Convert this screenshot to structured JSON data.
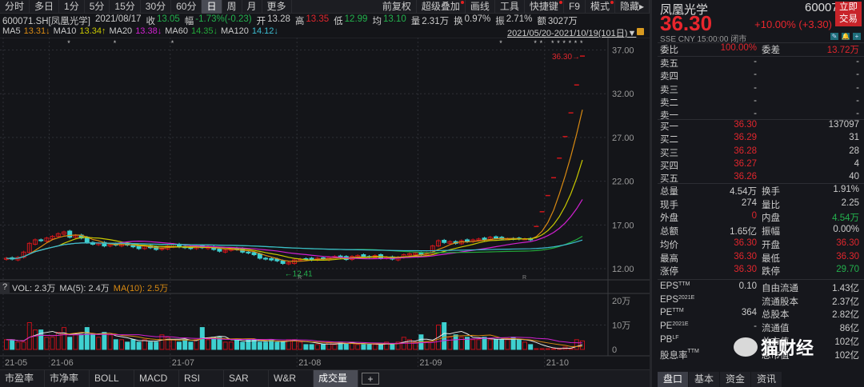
{
  "toolbar": {
    "left": [
      "分时",
      "多日",
      "1分",
      "5分",
      "15分",
      "30分",
      "60分",
      "日",
      "周",
      "月",
      "更多"
    ],
    "active": "日",
    "right": [
      {
        "label": "前复权",
        "dot": false
      },
      {
        "label": "超级叠加",
        "dot": true
      },
      {
        "label": "画线",
        "dot": false
      },
      {
        "label": "工具",
        "dot": false
      },
      {
        "label": "快捷键",
        "dot": true
      },
      {
        "label": "F9",
        "dot": false
      },
      {
        "label": "模式",
        "dot": true
      },
      {
        "label": "隐藏▸",
        "dot": false
      }
    ]
  },
  "info": {
    "symbol": "600071.SH[凤凰光学]",
    "date": "2021/08/17",
    "close_label": "收",
    "close": "13.05",
    "amp_label": "幅",
    "change": "-1.73%(-0.23)",
    "open_label": "开",
    "open": "13.28",
    "high_label": "高",
    "high": "13.35",
    "low_label": "低",
    "low": "12.99",
    "avg_label": "均",
    "avg": "13.10",
    "vol_label": "量",
    "vol": "2.31万",
    "turnover_label": "换",
    "turnover": "0.97%",
    "swing_label": "振",
    "swing": "2.71%",
    "amount_label": "额",
    "amount": "3027万"
  },
  "ma": [
    {
      "label": "MA5",
      "value": "13.31↓",
      "color": "#d98a12"
    },
    {
      "label": "MA10",
      "value": "13.34↑",
      "color": "#c8c800"
    },
    {
      "label": "MA20",
      "value": "13.38↓",
      "color": "#d020d0"
    },
    {
      "label": "MA60",
      "value": "14.35↓",
      "color": "#22a83a"
    },
    {
      "label": "MA120",
      "value": "14.12↓",
      "color": "#3cbcd0"
    }
  ],
  "range": "2021/05/20-2021/10/19(101日)▼",
  "chart_data": {
    "type": "candlestick",
    "ylim": [
      11,
      37.5
    ],
    "yticks": [
      "37.00",
      "32.00",
      "27.00",
      "22.00",
      "17.00",
      "12.00"
    ],
    "ytick_values": [
      37,
      32,
      27,
      22,
      17,
      12
    ],
    "last_label": "36.30→",
    "low_label": "←12.41",
    "low_index": 48,
    "low_value": 12.41,
    "xticks": [
      {
        "label": "21-05",
        "index": 0
      },
      {
        "label": "21-06",
        "index": 8
      },
      {
        "label": "21-07",
        "index": 29
      },
      {
        "label": "21-08",
        "index": 51
      },
      {
        "label": "21-09",
        "index": 72
      },
      {
        "label": "21-10",
        "index": 94
      }
    ],
    "star_indices": [
      11,
      19,
      29,
      86,
      92,
      93,
      95,
      96,
      97,
      98,
      99,
      100
    ],
    "r_indices": [
      51,
      90
    ],
    "close": [
      13.2,
      13.1,
      13.3,
      13.9,
      14.9,
      15.3,
      15.2,
      15.5,
      15.7,
      16.0,
      16.2,
      15.6,
      15.8,
      15.5,
      15.0,
      14.8,
      14.9,
      14.6,
      14.8,
      14.7,
      14.9,
      14.7,
      14.5,
      14.3,
      14.6,
      14.4,
      14.2,
      14.3,
      14.6,
      14.8,
      14.5,
      14.4,
      14.3,
      14.6,
      14.4,
      14.5,
      14.2,
      14.0,
      14.1,
      14.3,
      14.2,
      13.9,
      13.8,
      13.6,
      13.2,
      13.1,
      13.0,
      12.9,
      12.6,
      12.7,
      13.0,
      13.1,
      13.1,
      13.0,
      13.2,
      13.1,
      13.3,
      13.4,
      13.3,
      13.05,
      13.4,
      13.5,
      13.4,
      13.3,
      13.5,
      13.2,
      13.3,
      13.1,
      13.3,
      13.6,
      13.7,
      13.8,
      13.6,
      13.8,
      14.6,
      15.2,
      15.0,
      15.1,
      14.9,
      15.2,
      15.1,
      15.3,
      15.4,
      15.3,
      15.6,
      15.5,
      15.4,
      15.4,
      15.4,
      15.4,
      15.4,
      15.3,
      16.83,
      18.51,
      20.36,
      22.4,
      24.64,
      27.1,
      29.81,
      33.0,
      36.3
    ],
    "volume_label": "成交量",
    "vol_yticks": [
      "20万",
      "10万",
      "0"
    ],
    "vol_ytick_values": [
      20,
      10,
      0
    ],
    "vol_ylim": [
      0,
      22
    ],
    "volume": [
      4,
      4,
      3,
      3,
      11,
      8,
      8,
      5,
      5,
      7,
      9,
      5,
      6,
      6,
      9,
      6,
      5,
      7,
      6,
      4,
      4,
      3,
      4,
      3,
      4,
      3,
      3,
      6,
      5,
      4,
      3,
      4,
      3,
      4,
      9,
      4,
      5,
      5,
      3,
      3,
      4,
      3,
      4,
      4,
      3,
      3,
      4,
      3,
      3,
      4,
      4,
      3,
      2,
      2,
      2,
      2,
      3,
      2,
      3,
      2.3,
      3,
      2,
      2,
      2,
      2,
      2,
      3,
      2,
      3,
      5,
      4,
      3,
      6,
      3,
      3,
      10,
      11,
      5,
      6,
      5,
      5,
      4,
      4,
      5,
      4,
      4,
      4,
      4,
      5,
      4,
      3,
      2,
      0.3,
      0.3,
      0.3,
      0.3,
      0.5,
      1,
      0.4,
      4,
      3.5
    ]
  },
  "vol_header": {
    "help": "?",
    "vol": "VOL: 2.3万",
    "ma5": "MA(5): 2.4万",
    "ma10": "MA(10): 2.5万"
  },
  "tabs": [
    "市盈率",
    "市净率",
    "BOLL",
    "MACD",
    "RSI",
    "SAR",
    "W&R",
    "成交量"
  ],
  "active_tab": "成交量",
  "plus": "+",
  "panel": {
    "name": "凤凰光学",
    "code": "600071",
    "trade_btn": [
      "立即",
      "交易"
    ],
    "price": "36.30",
    "change": "+10.00% (+3.30)",
    "meta": "SSE  CNY  15:00:00  闭市",
    "icons": [
      "✎",
      "🔔",
      "+"
    ],
    "ratio": {
      "l1": "委比",
      "v1": "100.00%",
      "l2": "委差",
      "v2": "13.72万"
    },
    "asks": [
      {
        "label": "卖五",
        "price": "-",
        "vol": "-"
      },
      {
        "label": "卖四",
        "price": "-",
        "vol": "-"
      },
      {
        "label": "卖三",
        "price": "-",
        "vol": "-"
      },
      {
        "label": "卖二",
        "price": "-",
        "vol": "-"
      },
      {
        "label": "卖一",
        "price": "-",
        "vol": "-"
      }
    ],
    "bids": [
      {
        "label": "买一",
        "price": "36.30",
        "vol": "137097"
      },
      {
        "label": "买二",
        "price": "36.29",
        "vol": "31"
      },
      {
        "label": "买三",
        "price": "36.28",
        "vol": "28"
      },
      {
        "label": "买四",
        "price": "36.27",
        "vol": "4"
      },
      {
        "label": "买五",
        "price": "36.26",
        "vol": "40"
      }
    ],
    "stats": [
      {
        "l1": "总量",
        "v1": "4.54万",
        "c1": "w",
        "l2": "换手",
        "v2": "1.91%",
        "c2": "w"
      },
      {
        "l1": "现手",
        "v1": "274",
        "c1": "w",
        "l2": "量比",
        "v2": "2.25",
        "c2": "w"
      },
      {
        "l1": "外盘",
        "v1": "0",
        "c1": "r",
        "l2": "内盘",
        "v2": "4.54万",
        "c2": "g"
      },
      {
        "l1": "总额",
        "v1": "1.65亿",
        "c1": "w",
        "l2": "振幅",
        "v2": "0.00%",
        "c2": "w"
      },
      {
        "l1": "均价",
        "v1": "36.30",
        "c1": "r",
        "l2": "开盘",
        "v2": "36.30",
        "c2": "r"
      },
      {
        "l1": "最高",
        "v1": "36.30",
        "c1": "r",
        "l2": "最低",
        "v2": "36.30",
        "c2": "r"
      },
      {
        "l1": "涨停",
        "v1": "36.30",
        "c1": "r",
        "l2": "跌停",
        "v2": "29.70",
        "c2": "g"
      }
    ],
    "fund": [
      {
        "l1": "EPS",
        "s1": "TTM",
        "v1": "0.10",
        "l2": "自由流通",
        "v2": "1.43亿"
      },
      {
        "l1": "EPS",
        "s1": "2021E",
        "v1": "",
        "l2": "流通股本",
        "v2": "2.37亿"
      },
      {
        "l1": "PE",
        "s1": "TTM",
        "v1": "364",
        "l2": "总股本",
        "v2": "2.82亿"
      },
      {
        "l1": "PE",
        "s1": "2021E",
        "v1": "-",
        "l2": "流通值",
        "v2": "86亿"
      },
      {
        "l1": "PB",
        "s1": "LF",
        "v1": "",
        "l2": "总市值",
        "v2": "102亿"
      },
      {
        "l1": "股息率",
        "s1": "TTM",
        "v1": "",
        "l2": "总市值",
        "v2": "102亿"
      }
    ],
    "tabs": [
      "盘口",
      "基本",
      "资金",
      "资讯"
    ],
    "active_tab": "盘口"
  },
  "watermark": "猫财经"
}
